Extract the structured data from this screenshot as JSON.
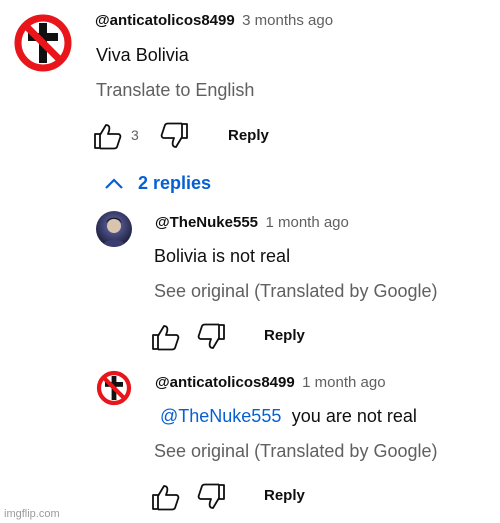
{
  "comment": {
    "author": "@anticatolicos8499",
    "time": "3 months ago",
    "text": "Viva Bolivia",
    "translate_label": "Translate to English",
    "like_count": "3",
    "reply_label": "Reply"
  },
  "replies_toggle": {
    "label": "2 replies"
  },
  "replies": [
    {
      "author": "@TheNuke555",
      "time": "1 month ago",
      "text": "Bolivia is not real",
      "translate_label": "See original (Translated by Google)",
      "reply_label": "Reply"
    },
    {
      "author": "@anticatolicos8499",
      "time": "1 month ago",
      "mention": "@TheNuke555",
      "text": "you are not real",
      "translate_label": "See original (Translated by Google)",
      "reply_label": "Reply"
    }
  ],
  "watermark": "imgflip.com",
  "colors": {
    "link_blue": "#065fd4",
    "secondary_text": "#606060",
    "no_symbol_red": "#e8161b"
  }
}
